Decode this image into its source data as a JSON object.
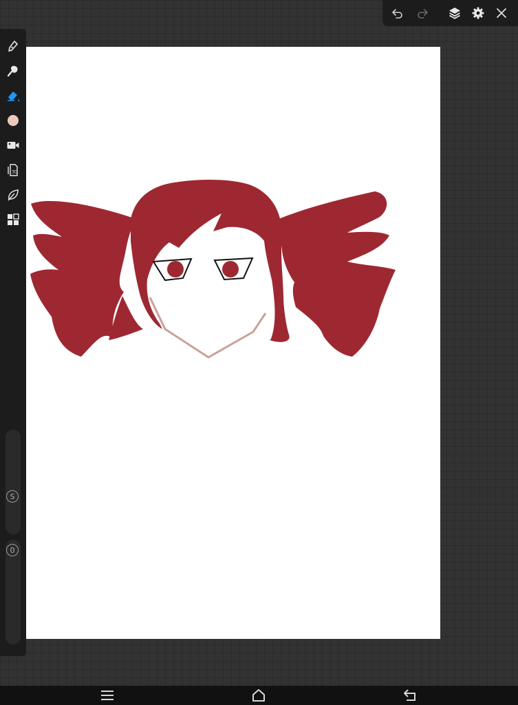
{
  "app": {
    "canvas_color": "#ffffff",
    "accent_color": "#2196f3",
    "current_color": "#ecc9bd"
  },
  "top_bar": {
    "icons": [
      "undo-icon",
      "redo-icon",
      "layers-icon",
      "gear-icon",
      "close-icon"
    ]
  },
  "left_toolbar": {
    "tools": [
      {
        "name": "brush-tool",
        "icon": "pen-icon",
        "active": false
      },
      {
        "name": "smudge-tool",
        "icon": "smudge-icon",
        "active": false
      },
      {
        "name": "eraser-tool",
        "icon": "eraser-icon",
        "active": true
      },
      {
        "name": "color-picker",
        "icon": "color-swatch-icon",
        "active": false
      },
      {
        "name": "record-tool",
        "icon": "video-camera-icon",
        "active": false
      },
      {
        "name": "3d-tool",
        "icon": "3d-icon",
        "active": false
      },
      {
        "name": "leaf-tool",
        "icon": "leaf-icon",
        "active": false
      },
      {
        "name": "grid-tool",
        "icon": "grid-icon",
        "active": false
      }
    ],
    "size_label": "S",
    "opacity_label": "0"
  },
  "drawing": {
    "hair_color": "#9e2832",
    "skin_outline_color": "#c9a09a",
    "eye_outline_color": "#111111"
  },
  "bottom_nav": {
    "icons": [
      "menu-icon",
      "home-icon",
      "back-icon"
    ]
  }
}
